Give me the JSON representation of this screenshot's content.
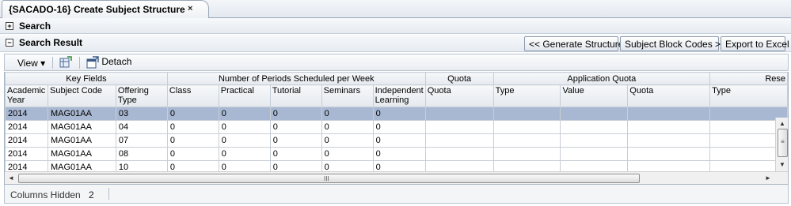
{
  "tab": {
    "title": "{SACADO-16} Create Subject Structure",
    "close_glyph": "×"
  },
  "search_section": {
    "title": "Search",
    "toggle": "+"
  },
  "result_section": {
    "title": "Search Result",
    "toggle": "−",
    "buttons": {
      "generate": "<< Generate Structure",
      "block_codes": "Subject Block Codes >>",
      "export": "Export to Excel"
    }
  },
  "toolbar": {
    "view_label": "View",
    "view_arrow": "▾",
    "detach_label": "Detach"
  },
  "table": {
    "groups": {
      "key_fields": "Key Fields",
      "periods": "Number of Periods Scheduled per Week",
      "quota": "Quota",
      "application_quota": "Application Quota",
      "reserved": "Rese"
    },
    "columns": [
      "Academic Year",
      "Subject Code",
      "Offering Type",
      "Class",
      "Practical",
      "Tutorial",
      "Seminars",
      "Independent Learning",
      "Quota",
      "Type",
      "Value",
      "Quota",
      "Type"
    ],
    "rows": [
      [
        "2014",
        "MAG01AA",
        "03",
        "0",
        "0",
        "0",
        "0",
        "0",
        "",
        "",
        "",
        "",
        ""
      ],
      [
        "2014",
        "MAG01AA",
        "04",
        "0",
        "0",
        "0",
        "0",
        "0",
        "",
        "",
        "",
        "",
        ""
      ],
      [
        "2014",
        "MAG01AA",
        "07",
        "0",
        "0",
        "0",
        "0",
        "0",
        "",
        "",
        "",
        "",
        ""
      ],
      [
        "2014",
        "MAG01AA",
        "08",
        "0",
        "0",
        "0",
        "0",
        "0",
        "",
        "",
        "",
        "",
        ""
      ],
      [
        "2014",
        "MAG01AA",
        "10",
        "0",
        "0",
        "0",
        "0",
        "0",
        "",
        "",
        "",
        "",
        ""
      ]
    ],
    "selected_row": 0
  },
  "scrollbar": {
    "up": "▲",
    "down": "▼",
    "left": "◄",
    "right": "►",
    "grip_v": "≡",
    "grip_h": "III"
  },
  "status": {
    "label": "Columns Hidden",
    "value": "2"
  },
  "colors": {
    "selected_row": "#a9b8d2",
    "header_bg": "#e5e9ee"
  }
}
